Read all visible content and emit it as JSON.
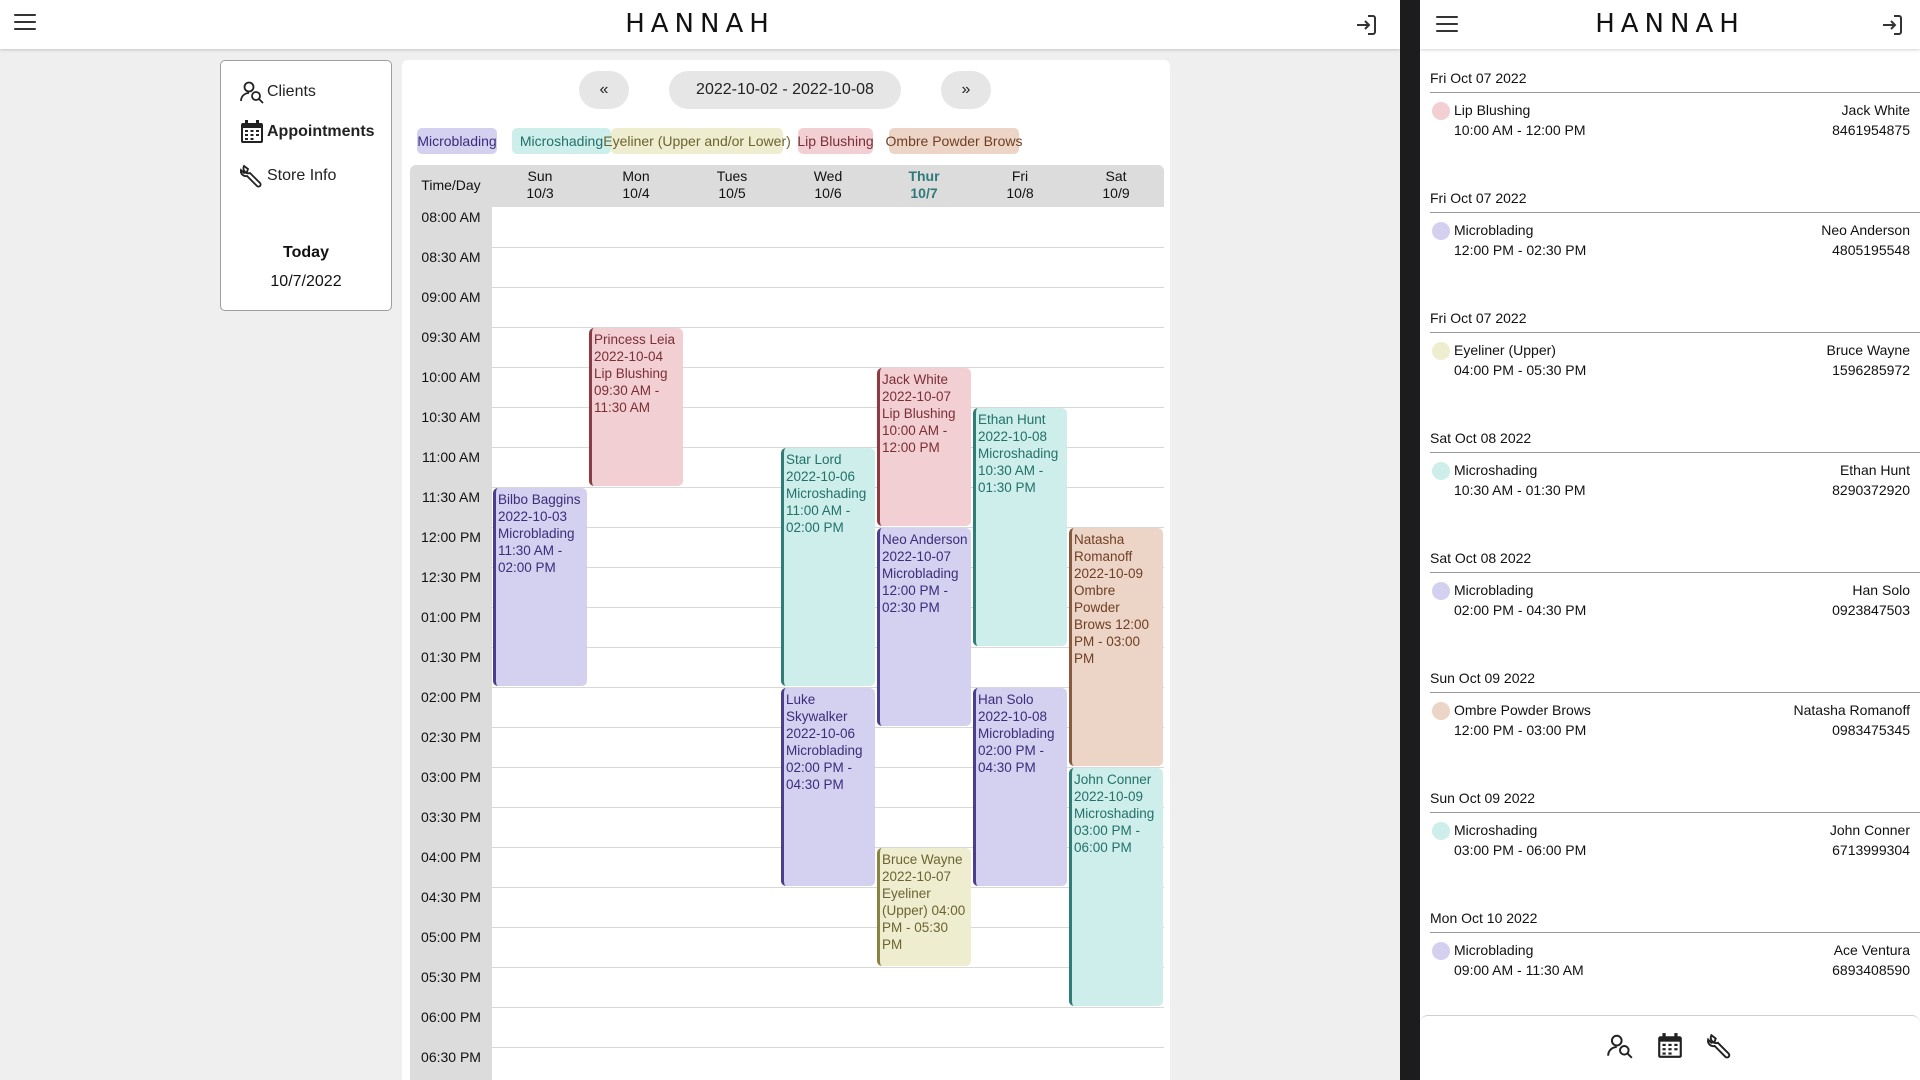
{
  "app": {
    "brand": "HANNAH"
  },
  "nav": {
    "clients": "Clients",
    "appointments": "Appointments",
    "store_info": "Store Info",
    "today_label": "Today",
    "today_date": "10/7/2022"
  },
  "toolbar": {
    "prev": "«",
    "range": "2022-10-02 - 2022-10-08",
    "next": "»"
  },
  "services": [
    {
      "name": "Microblading",
      "bg": "#d4d0ef",
      "fg": "#3a2d7a",
      "border": "#4a3f8f"
    },
    {
      "name": "Microshading",
      "bg": "#cdeeea",
      "fg": "#23706a",
      "border": "#2f7d77"
    },
    {
      "name": "Eyeliner (Upper and/or Lower)",
      "bg": "#efedcf",
      "fg": "#6b6330",
      "border": "#8b8140"
    },
    {
      "name": "Lip Blushing",
      "bg": "#f2cfd3",
      "fg": "#7a2f36",
      "border": "#8d3a41"
    },
    {
      "name": "Ombre Powder Brows",
      "bg": "#ecd5c6",
      "fg": "#6f3e24",
      "border": "#8a5a3c"
    }
  ],
  "calendar": {
    "time_header": "Time/Day",
    "days": [
      {
        "name": "Sun",
        "date": "10/3",
        "today": false
      },
      {
        "name": "Mon",
        "date": "10/4",
        "today": false
      },
      {
        "name": "Tues",
        "date": "10/5",
        "today": false
      },
      {
        "name": "Wed",
        "date": "10/6",
        "today": false
      },
      {
        "name": "Thur",
        "date": "10/7",
        "today": true
      },
      {
        "name": "Fri",
        "date": "10/8",
        "today": false
      },
      {
        "name": "Sat",
        "date": "10/9",
        "today": false
      }
    ],
    "times": [
      "08:00 AM",
      "08:30 AM",
      "09:00 AM",
      "09:30 AM",
      "10:00 AM",
      "10:30 AM",
      "11:00 AM",
      "11:30 AM",
      "12:00 PM",
      "12:30 PM",
      "01:00 PM",
      "01:30 PM",
      "02:00 PM",
      "02:30 PM",
      "03:00 PM",
      "03:30 PM",
      "04:00 PM",
      "04:30 PM",
      "05:00 PM",
      "05:30 PM",
      "06:00 PM",
      "06:30 PM"
    ],
    "appointments": [
      {
        "day": 1,
        "start": 3,
        "slots": 4,
        "service": 3,
        "text": "Princess Leia 2022-10-04 Lip Blushing 09:30 AM - 11:30 AM"
      },
      {
        "day": 0,
        "start": 7,
        "slots": 5,
        "service": 0,
        "text": "Bilbo Baggins 2022-10-03 Microblading 11:30 AM - 02:00 PM"
      },
      {
        "day": 3,
        "start": 6,
        "slots": 6,
        "service": 1,
        "text": "Star Lord 2022-10-06 Microshading 11:00 AM - 02:00 PM"
      },
      {
        "day": 3,
        "start": 12,
        "slots": 5,
        "service": 0,
        "text": "Luke Skywalker 2022-10-06 Microblading 02:00 PM - 04:30 PM"
      },
      {
        "day": 4,
        "start": 4,
        "slots": 4,
        "service": 3,
        "text": "Jack White 2022-10-07 Lip Blushing 10:00 AM - 12:00 PM"
      },
      {
        "day": 4,
        "start": 8,
        "slots": 5,
        "service": 0,
        "text": "Neo Anderson 2022-10-07 Microblading 12:00 PM - 02:30 PM"
      },
      {
        "day": 4,
        "start": 16,
        "slots": 3,
        "service": 2,
        "text": "Bruce Wayne 2022-10-07 Eyeliner (Upper) 04:00 PM - 05:30 PM"
      },
      {
        "day": 5,
        "start": 5,
        "slots": 6,
        "service": 1,
        "text": "Ethan Hunt 2022-10-08 Microshading 10:30 AM - 01:30 PM"
      },
      {
        "day": 5,
        "start": 12,
        "slots": 5,
        "service": 0,
        "text": "Han Solo 2022-10-08 Microblading 02:00 PM - 04:30 PM"
      },
      {
        "day": 6,
        "start": 8,
        "slots": 6,
        "service": 4,
        "text": "Natasha Romanoff 2022-10-09 Ombre Powder Brows 12:00 PM - 03:00 PM"
      },
      {
        "day": 6,
        "start": 14,
        "slots": 6,
        "service": 1,
        "text": "John Conner 2022-10-09 Microshading 03:00 PM - 06:00 PM"
      }
    ]
  },
  "mobile": {
    "brand": "HANNAH",
    "list": [
      {
        "date": "Fri Oct 07 2022",
        "service": "Lip Blushing",
        "color": "#f2cfd3",
        "time": "10:00 AM - 12:00 PM",
        "name": "Jack White",
        "phone": "8461954875"
      },
      {
        "date": "Fri Oct 07 2022",
        "service": "Microblading",
        "color": "#d4d0ef",
        "time": "12:00 PM - 02:30 PM",
        "name": "Neo Anderson",
        "phone": "4805195548"
      },
      {
        "date": "Fri Oct 07 2022",
        "service": "Eyeliner (Upper)",
        "color": "#efedcf",
        "time": "04:00 PM - 05:30 PM",
        "name": "Bruce Wayne",
        "phone": "1596285972"
      },
      {
        "date": "Sat Oct 08 2022",
        "service": "Microshading",
        "color": "#cdeeea",
        "time": "10:30 AM - 01:30 PM",
        "name": "Ethan Hunt",
        "phone": "8290372920"
      },
      {
        "date": "Sat Oct 08 2022",
        "service": "Microblading",
        "color": "#d4d0ef",
        "time": "02:00 PM - 04:30 PM",
        "name": "Han Solo",
        "phone": "0923847503"
      },
      {
        "date": "Sun Oct 09 2022",
        "service": "Ombre Powder Brows",
        "color": "#ecd5c6",
        "time": "12:00 PM - 03:00 PM",
        "name": "Natasha Romanoff",
        "phone": "0983475345"
      },
      {
        "date": "Sun Oct 09 2022",
        "service": "Microshading",
        "color": "#cdeeea",
        "time": "03:00 PM - 06:00 PM",
        "name": "John Conner",
        "phone": "6713999304"
      },
      {
        "date": "Mon Oct 10 2022",
        "service": "Microblading",
        "color": "#d4d0ef",
        "time": "09:00 AM - 11:30 AM",
        "name": "Ace Ventura",
        "phone": "6893408590"
      }
    ]
  }
}
